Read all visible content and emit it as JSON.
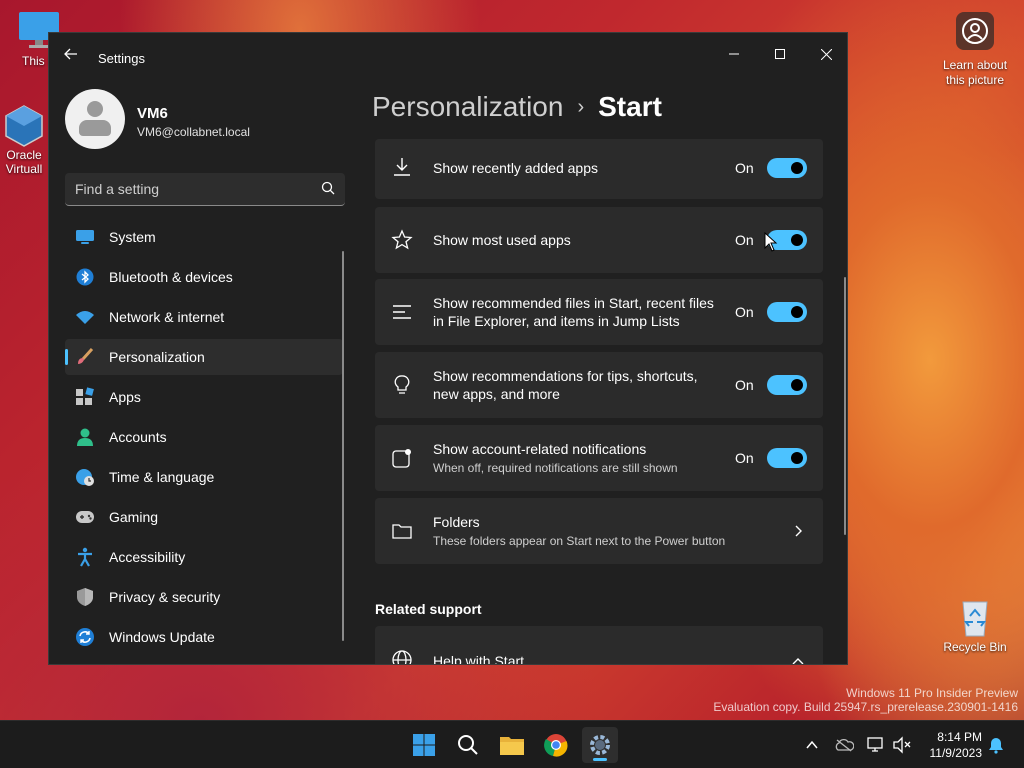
{
  "desktop": {
    "icons": [
      {
        "label": "This P",
        "icon": "monitor-icon"
      },
      {
        "label": "Oracle\nVirtuall",
        "icon": "virtualbox-icon"
      },
      {
        "label": "Recycle Bin",
        "icon": "recycle-bin-icon"
      }
    ],
    "learn_label": "Learn about this picture",
    "watermark_line1": "Windows 11 Pro Insider Preview",
    "watermark_line2": "Evaluation copy. Build 25947.rs_prerelease.230901-1416"
  },
  "window": {
    "title": "Settings",
    "controls": {
      "minimize": "minimize-icon",
      "maximize": "maximize-icon",
      "close": "close-icon"
    }
  },
  "profile": {
    "name": "VM6",
    "email": "VM6@collabnet.local"
  },
  "search": {
    "placeholder": "Find a setting"
  },
  "nav": {
    "items": [
      {
        "label": "System",
        "icon": "system-icon"
      },
      {
        "label": "Bluetooth & devices",
        "icon": "bluetooth-icon"
      },
      {
        "label": "Network & internet",
        "icon": "wifi-icon"
      },
      {
        "label": "Personalization",
        "icon": "brush-icon",
        "active": true
      },
      {
        "label": "Apps",
        "icon": "apps-icon"
      },
      {
        "label": "Accounts",
        "icon": "accounts-icon"
      },
      {
        "label": "Time & language",
        "icon": "globe-clock-icon"
      },
      {
        "label": "Gaming",
        "icon": "gamepad-icon"
      },
      {
        "label": "Accessibility",
        "icon": "accessibility-icon"
      },
      {
        "label": "Privacy & security",
        "icon": "shield-icon"
      },
      {
        "label": "Windows Update",
        "icon": "update-icon"
      }
    ]
  },
  "breadcrumb": {
    "parent": "Personalization",
    "separator": "›",
    "current": "Start"
  },
  "settings": [
    {
      "title": "Show recently added apps",
      "state": "On",
      "icon": "download-icon"
    },
    {
      "title": "Show most used apps",
      "state": "On",
      "icon": "star-icon"
    },
    {
      "title": "Show recommended files in Start, recent files",
      "title2": "in File Explorer, and items in Jump Lists",
      "state": "On",
      "icon": "list-icon"
    },
    {
      "title": "Show recommendations for tips, shortcuts,",
      "title2": "new apps, and more",
      "state": "On",
      "icon": "lightbulb-icon"
    },
    {
      "title": "Show account-related notifications",
      "desc": "When off, required notifications are still shown",
      "state": "On",
      "icon": "notification-icon"
    },
    {
      "title": "Folders",
      "desc": "These folders appear on Start next to the Power button",
      "icon": "folder-icon"
    }
  ],
  "related": {
    "heading": "Related support",
    "help_title": "Help with Start"
  },
  "taskbar": {
    "apps": [
      "start-icon",
      "search-icon",
      "file-explorer-icon",
      "chrome-icon",
      "settings-icon"
    ],
    "tray": [
      "chevron-up-icon",
      "onedrive-icon",
      "network-icon",
      "volume-muted-icon",
      "notification-bell-icon"
    ],
    "time": "8:14 PM",
    "date": "11/9/2023"
  },
  "colors": {
    "accent": "#4cc2ff",
    "window_bg": "#202020",
    "card_bg": "#2b2b2b"
  }
}
